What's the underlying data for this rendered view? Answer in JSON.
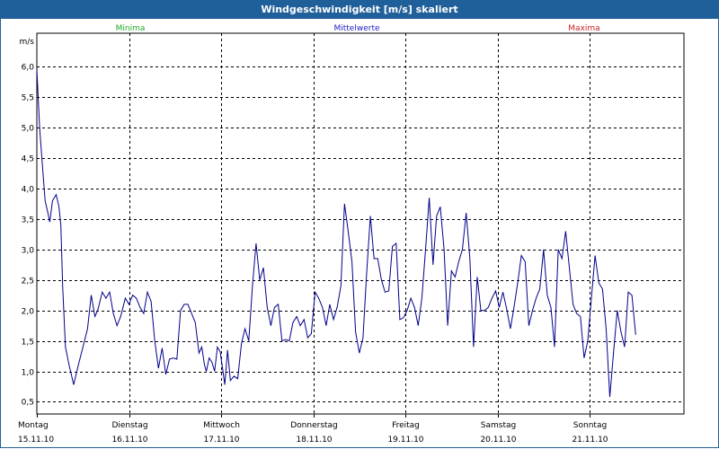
{
  "window": {
    "title": "Windgeschwindigkeit [m/s] skaliert"
  },
  "legend": [
    {
      "label": "Minima",
      "color": "#22aa22"
    },
    {
      "label": "Mittelwerte",
      "color": "#2222cc"
    },
    {
      "label": "Maxima",
      "color": "#cc2222"
    }
  ],
  "chart_data": {
    "type": "line",
    "ylabel": "m/s",
    "ylim": [
      0.3,
      6.55
    ],
    "y_ticks": [
      "6,0",
      "5,5",
      "5,0",
      "4,5",
      "4,0",
      "3,5",
      "3,0",
      "2,5",
      "2,0",
      "1,5",
      "1,0",
      "0,5"
    ],
    "y_tick_values": [
      6.0,
      5.5,
      5.0,
      4.5,
      4.0,
      3.5,
      3.0,
      2.5,
      2.0,
      1.5,
      1.0,
      0.5
    ],
    "grid": true,
    "x_ticks": [
      {
        "day": "Montag",
        "date": "15.11.10"
      },
      {
        "day": "Dienstag",
        "date": "16.11.10"
      },
      {
        "day": "Mittwoch",
        "date": "17.11.10"
      },
      {
        "day": "Donnerstag",
        "date": "18.11.10"
      },
      {
        "day": "Freitag",
        "date": "19.11.10"
      },
      {
        "day": "Samstag",
        "date": "20.11.10"
      },
      {
        "day": "Sonntag",
        "date": "21.11.10"
      }
    ],
    "xlim_days": [
      0,
      7.1
    ],
    "series": [
      {
        "name": "Mittelwerte",
        "color": "#00008b",
        "points": [
          [
            0.0,
            5.95
          ],
          [
            0.03,
            5.0
          ],
          [
            0.06,
            4.4
          ],
          [
            0.09,
            3.8
          ],
          [
            0.12,
            3.6
          ],
          [
            0.14,
            3.45
          ],
          [
            0.17,
            3.8
          ],
          [
            0.21,
            3.9
          ],
          [
            0.24,
            3.7
          ],
          [
            0.26,
            3.4
          ],
          [
            0.28,
            2.4
          ],
          [
            0.31,
            1.4
          ],
          [
            0.35,
            1.1
          ],
          [
            0.4,
            0.78
          ],
          [
            0.45,
            1.1
          ],
          [
            0.5,
            1.4
          ],
          [
            0.55,
            1.7
          ],
          [
            0.59,
            2.25
          ],
          [
            0.63,
            1.9
          ],
          [
            0.66,
            2.0
          ],
          [
            0.71,
            2.3
          ],
          [
            0.75,
            2.2
          ],
          [
            0.79,
            2.3
          ],
          [
            0.83,
            1.95
          ],
          [
            0.87,
            1.75
          ],
          [
            0.91,
            1.9
          ],
          [
            0.96,
            2.2
          ],
          [
            1.0,
            2.1
          ],
          [
            1.04,
            2.25
          ],
          [
            1.08,
            2.2
          ],
          [
            1.12,
            2.05
          ],
          [
            1.16,
            1.95
          ],
          [
            1.2,
            2.3
          ],
          [
            1.24,
            2.15
          ],
          [
            1.28,
            1.5
          ],
          [
            1.32,
            1.05
          ],
          [
            1.36,
            1.38
          ],
          [
            1.4,
            0.95
          ],
          [
            1.44,
            1.2
          ],
          [
            1.48,
            1.22
          ],
          [
            1.52,
            1.2
          ],
          [
            1.56,
            2.0
          ],
          [
            1.6,
            2.1
          ],
          [
            1.64,
            2.1
          ],
          [
            1.68,
            1.95
          ],
          [
            1.72,
            1.8
          ],
          [
            1.76,
            1.3
          ],
          [
            1.79,
            1.4
          ],
          [
            1.82,
            1.1
          ],
          [
            1.84,
            1.0
          ],
          [
            1.87,
            1.22
          ],
          [
            1.9,
            1.15
          ],
          [
            1.93,
            1.0
          ],
          [
            1.96,
            1.4
          ],
          [
            1.99,
            1.32
          ],
          [
            2.02,
            1.0
          ],
          [
            2.04,
            0.78
          ],
          [
            2.07,
            1.35
          ],
          [
            2.1,
            0.85
          ],
          [
            2.14,
            0.92
          ],
          [
            2.18,
            0.88
          ],
          [
            2.22,
            1.45
          ],
          [
            2.26,
            1.7
          ],
          [
            2.3,
            1.5
          ],
          [
            2.34,
            2.4
          ],
          [
            2.38,
            3.1
          ],
          [
            2.42,
            2.5
          ],
          [
            2.46,
            2.7
          ],
          [
            2.5,
            2.05
          ],
          [
            2.54,
            1.75
          ],
          [
            2.58,
            2.05
          ],
          [
            2.62,
            2.1
          ],
          [
            2.66,
            1.5
          ],
          [
            2.7,
            1.52
          ],
          [
            2.74,
            1.5
          ],
          [
            2.78,
            1.8
          ],
          [
            2.82,
            1.9
          ],
          [
            2.86,
            1.75
          ],
          [
            2.9,
            1.85
          ],
          [
            2.94,
            1.55
          ],
          [
            2.98,
            1.62
          ],
          [
            3.02,
            2.3
          ],
          [
            3.06,
            2.2
          ],
          [
            3.1,
            2.05
          ],
          [
            3.14,
            1.75
          ],
          [
            3.18,
            2.1
          ],
          [
            3.22,
            1.85
          ],
          [
            3.26,
            2.05
          ],
          [
            3.3,
            2.4
          ],
          [
            3.34,
            3.75
          ],
          [
            3.38,
            3.3
          ],
          [
            3.42,
            2.8
          ],
          [
            3.46,
            1.65
          ],
          [
            3.5,
            1.3
          ],
          [
            3.54,
            1.55
          ],
          [
            3.58,
            2.6
          ],
          [
            3.62,
            3.55
          ],
          [
            3.66,
            2.85
          ],
          [
            3.7,
            2.85
          ],
          [
            3.74,
            2.5
          ],
          [
            3.78,
            2.3
          ],
          [
            3.82,
            2.32
          ],
          [
            3.86,
            3.05
          ],
          [
            3.9,
            3.1
          ],
          [
            3.94,
            1.85
          ],
          [
            3.98,
            1.88
          ],
          [
            4.02,
            2.0
          ],
          [
            4.06,
            2.2
          ],
          [
            4.1,
            2.05
          ],
          [
            4.14,
            1.75
          ],
          [
            4.18,
            2.2
          ],
          [
            4.22,
            3.0
          ],
          [
            4.26,
            3.85
          ],
          [
            4.3,
            2.75
          ],
          [
            4.34,
            3.55
          ],
          [
            4.38,
            3.7
          ],
          [
            4.42,
            3.0
          ],
          [
            4.46,
            1.75
          ],
          [
            4.5,
            2.65
          ],
          [
            4.54,
            2.55
          ],
          [
            4.58,
            2.8
          ],
          [
            4.62,
            3.0
          ],
          [
            4.66,
            3.6
          ],
          [
            4.7,
            2.85
          ],
          [
            4.74,
            1.4
          ],
          [
            4.78,
            2.55
          ],
          [
            4.82,
            2.0
          ],
          [
            4.86,
            2.0
          ],
          [
            4.9,
            2.05
          ],
          [
            4.94,
            2.2
          ],
          [
            4.98,
            2.32
          ],
          [
            5.02,
            2.05
          ],
          [
            5.06,
            2.3
          ],
          [
            5.1,
            2.02
          ],
          [
            5.14,
            1.7
          ],
          [
            5.18,
            2.05
          ],
          [
            5.22,
            2.45
          ],
          [
            5.26,
            2.9
          ],
          [
            5.3,
            2.8
          ],
          [
            5.34,
            1.75
          ],
          [
            5.38,
            2.0
          ],
          [
            5.42,
            2.2
          ],
          [
            5.46,
            2.35
          ],
          [
            5.5,
            3.0
          ],
          [
            5.54,
            2.25
          ],
          [
            5.58,
            2.05
          ],
          [
            5.62,
            1.4
          ],
          [
            5.66,
            3.0
          ],
          [
            5.7,
            2.85
          ],
          [
            5.74,
            3.3
          ],
          [
            5.78,
            2.7
          ],
          [
            5.82,
            2.1
          ],
          [
            5.86,
            1.95
          ],
          [
            5.9,
            1.9
          ],
          [
            5.94,
            1.22
          ],
          [
            5.98,
            1.5
          ],
          [
            6.02,
            2.2
          ],
          [
            6.06,
            2.9
          ],
          [
            6.1,
            2.45
          ],
          [
            6.14,
            2.35
          ],
          [
            6.18,
            1.7
          ],
          [
            6.22,
            0.58
          ],
          [
            6.26,
            1.3
          ],
          [
            6.3,
            2.0
          ],
          [
            6.34,
            1.65
          ],
          [
            6.38,
            1.4
          ],
          [
            6.42,
            2.3
          ],
          [
            6.46,
            2.25
          ],
          [
            6.5,
            1.6
          ]
        ]
      }
    ]
  }
}
